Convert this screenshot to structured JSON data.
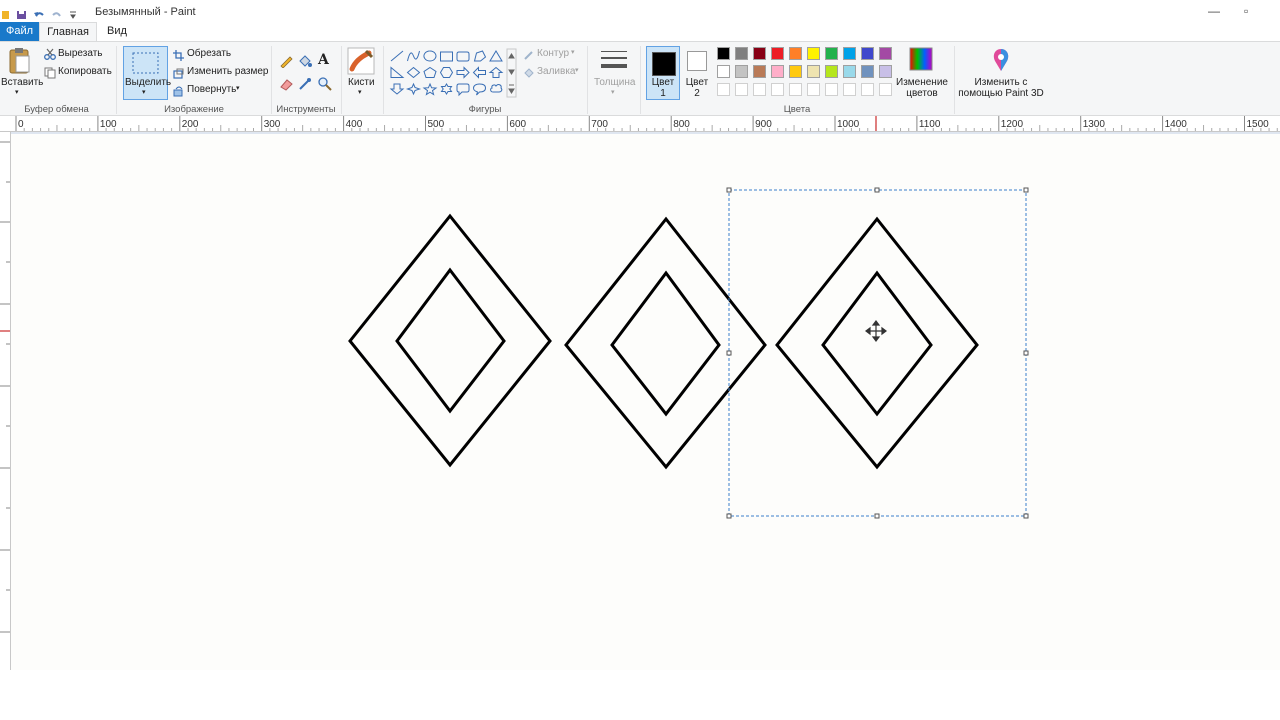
{
  "window": {
    "title": "Безымянный - Paint",
    "restore_glyph": "▫",
    "minimize_glyph": "—"
  },
  "tabs": [
    {
      "label": "Файл"
    },
    {
      "label": "Главная"
    },
    {
      "label": "Вид"
    }
  ],
  "clipboard": {
    "paste": "Вставить",
    "cut": "Вырезать",
    "copy": "Копировать",
    "group": "Буфер обмена"
  },
  "image": {
    "select": "Выделить",
    "crop": "Обрезать",
    "resize": "Изменить размер",
    "rotate": "Повернуть",
    "group": "Изображение"
  },
  "tools": {
    "group": "Инструменты",
    "text_glyph": "A"
  },
  "brushes": {
    "label": "Кисти"
  },
  "shapes": {
    "group": "Фигуры",
    "outline": "Контур",
    "fill": "Заливка"
  },
  "size": {
    "label": "Толщина"
  },
  "colors": {
    "color1_line1": "Цвет",
    "color1_line2": "1",
    "color2_line1": "Цвет",
    "color2_line2": "2",
    "group": "Цвета",
    "edit_line1": "Изменение",
    "edit_line2": "цветов",
    "color1_value": "#000000",
    "color2_value": "#ffffff",
    "palette_row1": [
      "#000000",
      "#7f7f7f",
      "#880015",
      "#ed1c24",
      "#ff7f27",
      "#fff200",
      "#22b14c",
      "#00a2e8",
      "#3f48cc",
      "#a349a4"
    ],
    "palette_row2": [
      "#ffffff",
      "#c3c3c3",
      "#b97a57",
      "#ffaec9",
      "#ffc90e",
      "#efe4b0",
      "#b5e61d",
      "#99d9ea",
      "#7092be",
      "#c8bfe7"
    ]
  },
  "paint3d": {
    "line1": "Изменить с",
    "line2": "помощью Paint 3D"
  },
  "ruler": {
    "ticks": [
      "0",
      "100",
      "200",
      "300",
      "400",
      "500",
      "600",
      "700",
      "800",
      "900",
      "1000",
      "1100",
      "1200",
      "1300",
      "1400",
      "1500"
    ]
  }
}
